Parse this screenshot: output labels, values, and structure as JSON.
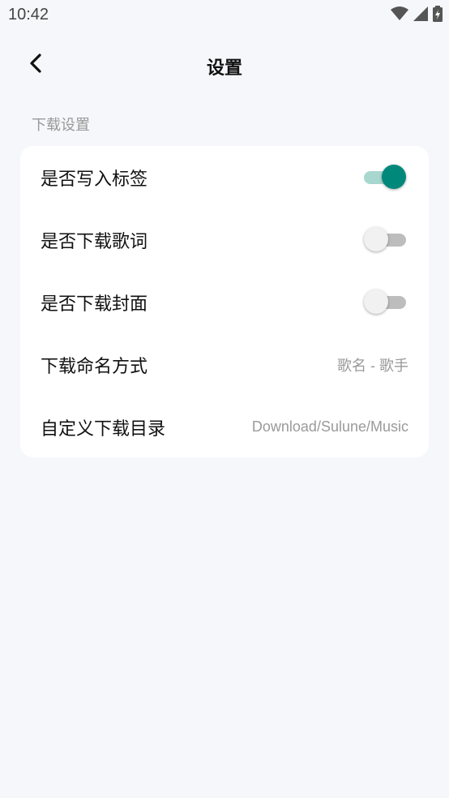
{
  "status_bar": {
    "time": "10:42",
    "icons": [
      "wifi-icon",
      "signal-icon",
      "battery-icon"
    ]
  },
  "app_bar": {
    "back_icon": "chevron-left-icon",
    "title": "设置"
  },
  "section": {
    "title": "下载设置"
  },
  "settings": {
    "write_tags": {
      "label": "是否写入标签",
      "enabled": true
    },
    "download_lyrics": {
      "label": "是否下载歌词",
      "enabled": false
    },
    "download_cover": {
      "label": "是否下载封面",
      "enabled": false
    },
    "naming_format": {
      "label": "下载命名方式",
      "value": "歌名 - 歌手"
    },
    "custom_dir": {
      "label": "自定义下载目录",
      "value": "Download/Sulune/Music"
    }
  },
  "colors": {
    "accent": "#00897b",
    "accent_track": "#a7d7cf",
    "background": "#f6f7fb",
    "card": "#ffffff",
    "secondary_text": "#9a9a9a"
  }
}
